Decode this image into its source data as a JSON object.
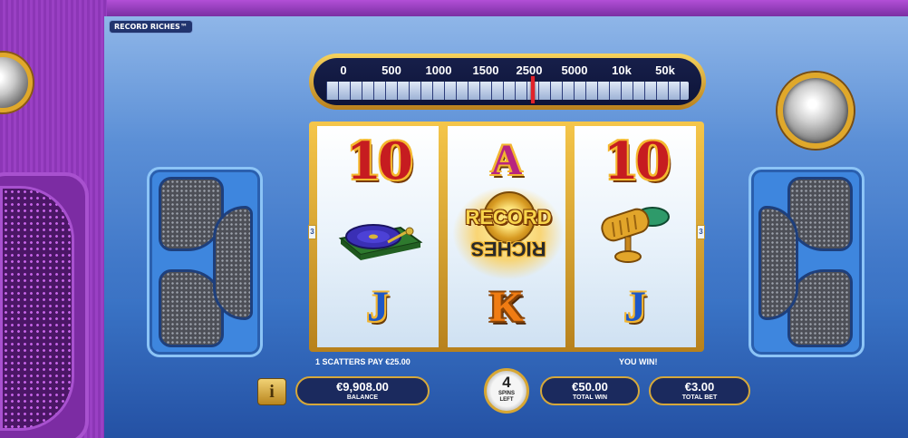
{
  "brand": {
    "title": "RECORD RICHES™"
  },
  "dial": {
    "labels": [
      "0",
      "500",
      "1000",
      "1500",
      "2500",
      "5000",
      "10k",
      "50k"
    ]
  },
  "reels": {
    "reel1": {
      "top": "10",
      "middle": "turntable-icon",
      "bottom": "J"
    },
    "reel2": {
      "top": "A",
      "middle": "RECORD RICHES",
      "bottom": "K"
    },
    "reel3": {
      "top": "10",
      "middle": "microphone-icon",
      "bottom": "J"
    }
  },
  "logo": {
    "line1": "RECORD",
    "line2": "RICHES"
  },
  "paylines": {
    "left": "3",
    "right": "3"
  },
  "messages": {
    "scatters": "1 SCATTERS PAY €25.00",
    "win": "YOU WIN!"
  },
  "bar": {
    "info_label": "i",
    "balance_value": "€9,908.00",
    "balance_caption": "BALANCE",
    "spins_count": "4",
    "spins_caption_1": "SPINS",
    "spins_caption_2": "LEFT",
    "total_win_value": "€50.00",
    "total_win_caption": "TOTAL WIN",
    "total_bet_value": "€3.00",
    "total_bet_caption": "TOTAL BET"
  },
  "colors": {
    "panel_blue": "#3f77c8",
    "frame_purple": "#8c36b6",
    "gold": "#d6a83a",
    "pill_navy": "#1b2a5e"
  }
}
